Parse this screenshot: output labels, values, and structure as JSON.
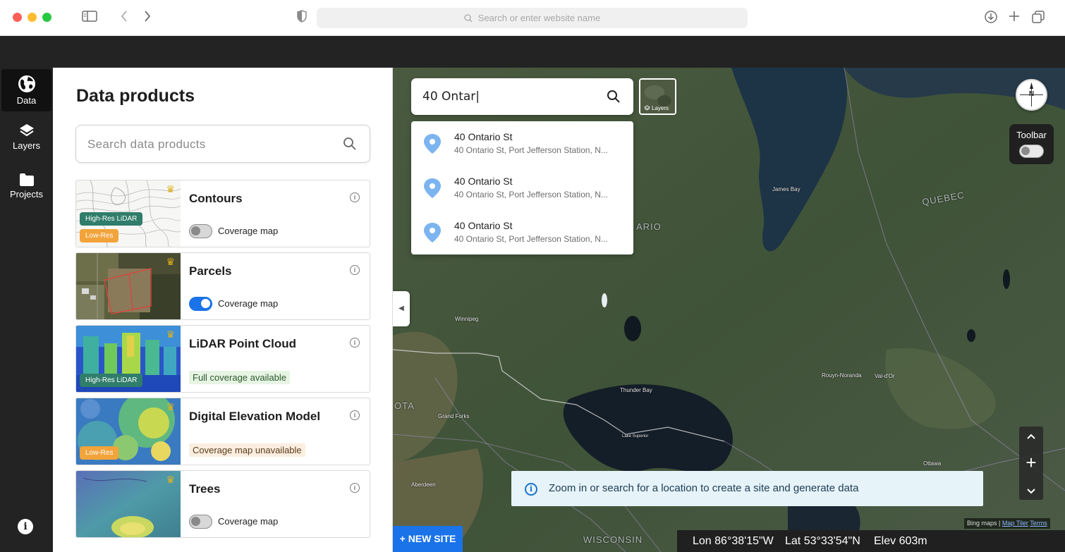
{
  "browser": {
    "url_placeholder": "Search or enter website name"
  },
  "rail": {
    "items": [
      {
        "label": "Data",
        "icon": "globe-icon",
        "active": true
      },
      {
        "label": "Layers",
        "icon": "layers-icon",
        "active": false
      },
      {
        "label": "Projects",
        "icon": "folder-icon",
        "active": false
      }
    ],
    "info_icon": "info-icon"
  },
  "panel": {
    "title": "Data products",
    "search_placeholder": "Search data products",
    "products": [
      {
        "title": "Contours",
        "tags": [
          "High-Res LiDAR",
          "Low-Res"
        ],
        "control": "toggle",
        "toggle_on": false,
        "label": "Coverage map"
      },
      {
        "title": "Parcels",
        "tags": [],
        "control": "toggle",
        "toggle_on": true,
        "label": "Coverage map"
      },
      {
        "title": "LiDAR Point Cloud",
        "tags": [
          "High-Res LiDAR"
        ],
        "control": "status",
        "label": "Full coverage available"
      },
      {
        "title": "Digital Elevation Model",
        "tags": [
          "Low-Res"
        ],
        "control": "status",
        "label": "Coverage map unavailable"
      },
      {
        "title": "Trees",
        "tags": [],
        "control": "toggle",
        "toggle_on": false,
        "label": "Coverage map"
      }
    ]
  },
  "map": {
    "search_value": "40 Ontar|",
    "layers_label": "Layers",
    "suggestions": [
      {
        "title": "40 Ontario St",
        "subtitle": "40 Ontario St, Port Jefferson Station, N..."
      },
      {
        "title": "40 Ontario St",
        "subtitle": "40 Ontario St, Port Jefferson Station, N..."
      },
      {
        "title": "40 Ontario St",
        "subtitle": "40 Ontario St, Port Jefferson Station, N..."
      }
    ],
    "compass_label": "N",
    "toolbar_label": "Toolbar",
    "zoom_in": "+",
    "banner_text": "Zoom in or search for a location to create a site and generate data",
    "new_site_label": "+ NEW SITE",
    "coords": {
      "lon": "Lon 86°38'15\"W",
      "lat": "Lat 53°33'54\"N",
      "elev": "Elev 603m"
    },
    "attribution": {
      "bing": "Bing maps |",
      "maptiler": "Map Tiler",
      "terms": "Terms"
    },
    "place_labels": {
      "quebec": "QUEBEC",
      "ontario": "ARIO",
      "james_bay": "James Bay",
      "winnipeg": "Winnipeg",
      "thunder_bay": "Thunder Bay",
      "grand_forks": "Grand Forks",
      "aberdeen": "Aberdeen",
      "rouyn": "Rouyn-Noranda",
      "val_dor": "Val-d'Or",
      "ottawa": "Ottawa",
      "wisconsin": "WISCONSIN",
      "ota": "OTA",
      "lake_superior": "Lake Superior"
    }
  },
  "colors": {
    "accent": "#1a73e8",
    "dark": "#232323",
    "hires_tag": "#2f7d6a",
    "lowres_tag": "#f2a33a"
  }
}
